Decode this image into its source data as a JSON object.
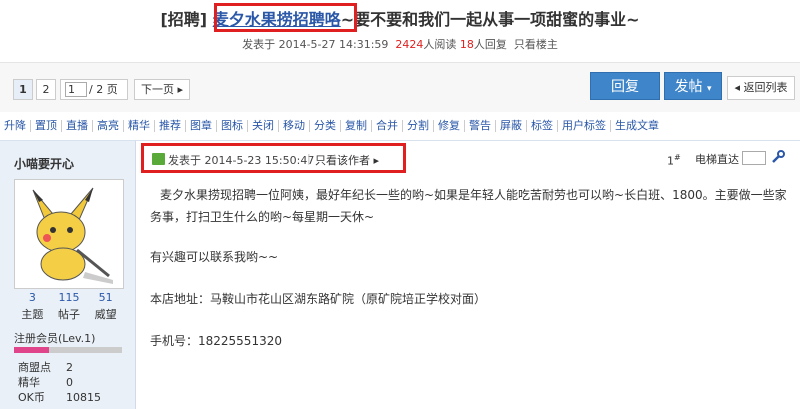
{
  "thread": {
    "tag": "[招聘]",
    "title_highlight": "麦夕水果捞招聘咯",
    "title_rest": "~要不要和我们一起从事一项甜蜜的事业~",
    "posted_label": "发表于",
    "posted_time": "2014-5-27 14:31:59",
    "views": "2424",
    "views_label": "人阅读",
    "replies": "18",
    "replies_label": "人回复",
    "only_op": "只看楼主"
  },
  "pager": {
    "page1": "1",
    "page2": "2",
    "input_value": "1",
    "total": "/ 2 页",
    "next": "下一页"
  },
  "actions": {
    "reply": "回复",
    "post": "发帖",
    "back": "返回列表"
  },
  "admin_tools": [
    "升降",
    "置顶",
    "直播",
    "高亮",
    "精华",
    "推荐",
    "图章",
    "图标",
    "关闭",
    "移动",
    "分类",
    "复制",
    "合并",
    "分割",
    "修复",
    "警告",
    "屏蔽",
    "标签",
    "用户标签",
    "生成文章"
  ],
  "user": {
    "name": "小喵要开心",
    "stats": [
      {
        "num": "3",
        "label": "主题"
      },
      {
        "num": "115",
        "label": "帖子"
      },
      {
        "num": "51",
        "label": "威望"
      }
    ],
    "level": "注册会员(Lev.1)",
    "level_progress": 0.32,
    "info": [
      {
        "k": "商盟点",
        "v": "2"
      },
      {
        "k": "精华",
        "v": "0"
      },
      {
        "k": "OK币",
        "v": "10815"
      }
    ]
  },
  "post": {
    "posted": "发表于 2014-5-23 15:50:47",
    "only_author": "只看该作者",
    "floor": "1",
    "floor_mark": "#",
    "lift_label": "电梯直达",
    "paragraphs": [
      "麦夕水果捞现招聘一位阿姨，最好年纪长一些的哟~如果是年轻人能吃苦耐劳也可以哟~长白班、1800。主要做一些家务事，打扫卫生什么的哟~每星期一天休~",
      "有兴趣可以联系我哟~~",
      "本店地址：马鞍山市花山区湖东路矿院（原矿院培正学校对面）",
      "手机号：18225551320"
    ]
  },
  "colors": {
    "accent": "#3e85c9",
    "highlight_box": "#e02020",
    "link": "#2a57a8",
    "level_bar": "#e0458c"
  }
}
